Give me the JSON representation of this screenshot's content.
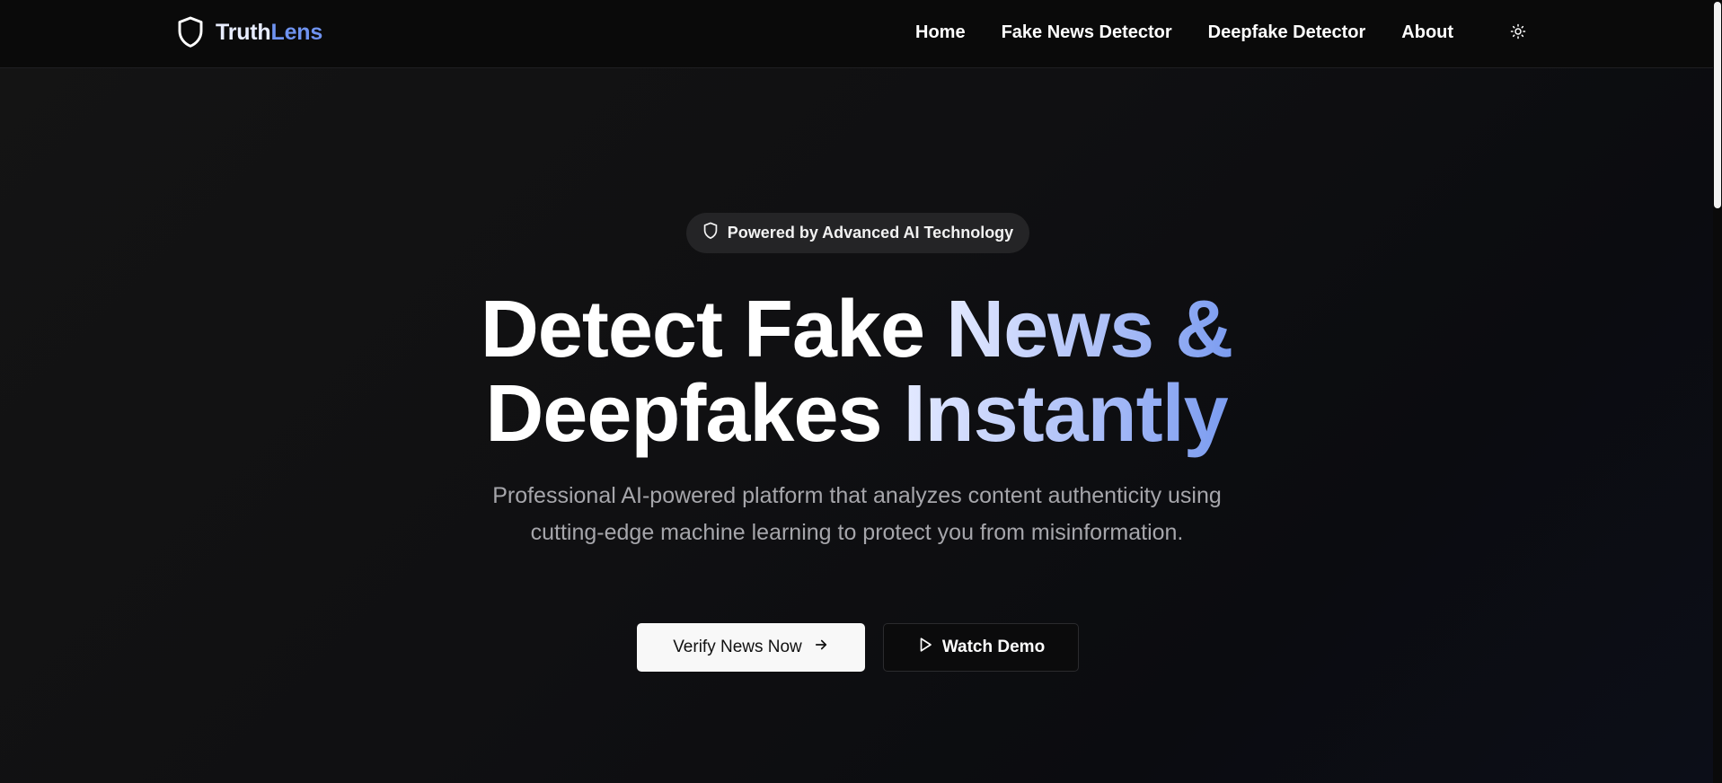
{
  "navbar": {
    "brand": {
      "part1": "Truth",
      "part2": "Lens",
      "logo_icon": "shield-icon"
    },
    "links": [
      {
        "label": "Home"
      },
      {
        "label": "Fake News Detector"
      },
      {
        "label": "Deepfake Detector"
      },
      {
        "label": "About"
      }
    ],
    "theme_toggle_icon": "sun-icon"
  },
  "hero": {
    "badge": {
      "icon": "shield-icon",
      "text": "Powered by Advanced AI Technology"
    },
    "headline": {
      "line1_white": "Detect Fake",
      "line1_gradient": "News &",
      "line2_white": "Deepfakes",
      "line2_gradient": "Instantly"
    },
    "subtitle": "Professional AI-powered platform that analyzes content authenticity using cutting-edge machine learning to protect you from misinformation.",
    "primary_button": {
      "label": "Verify News Now",
      "icon": "arrow-right-icon"
    },
    "secondary_button": {
      "label": "Watch Demo",
      "icon": "play-icon"
    }
  },
  "colors": {
    "background": "#0d0d0f",
    "accent_blue": "#6f93f0",
    "gradient_start": "#e3e9ff",
    "gradient_end": "#7b9cf0",
    "muted_text": "#a6a6ab"
  }
}
